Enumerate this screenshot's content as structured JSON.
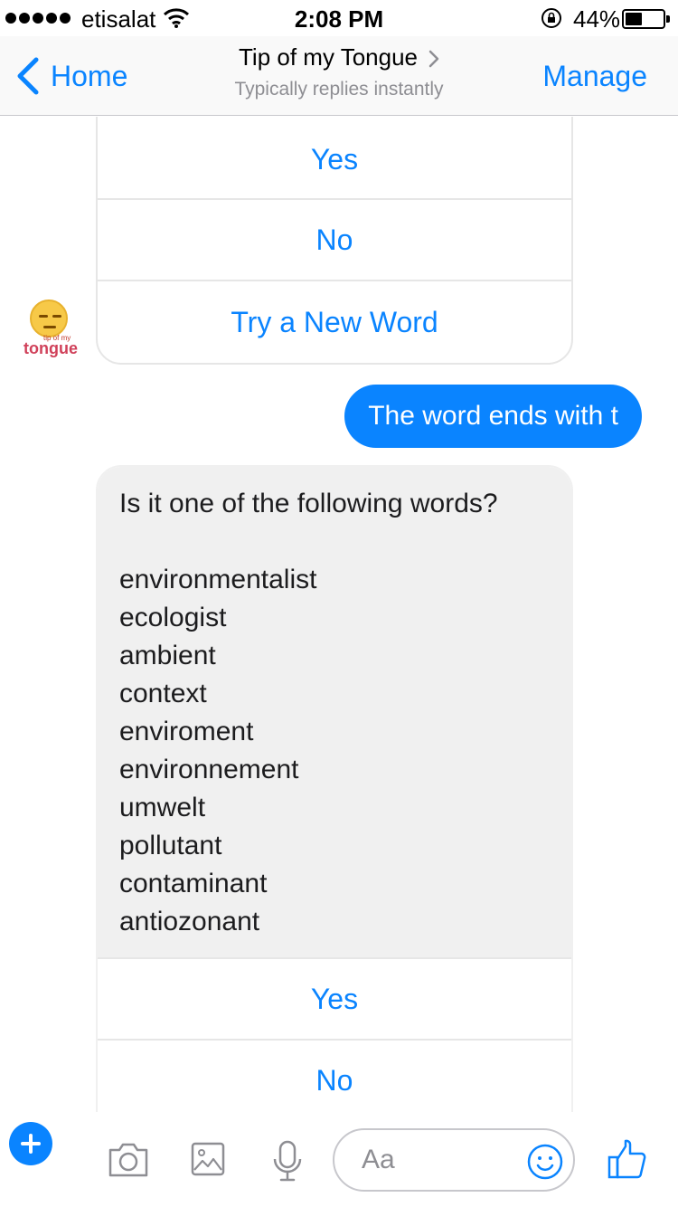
{
  "status_bar": {
    "carrier": "etisalat",
    "time": "2:08 PM",
    "battery_percent": "44%"
  },
  "nav": {
    "back_label": "Home",
    "title": "Tip of my Tongue",
    "subtitle": "Typically replies instantly",
    "manage_label": "Manage"
  },
  "avatar": {
    "small_text": "tip of my",
    "text": "tongue"
  },
  "first_card": {
    "replies": [
      "Yes",
      "No",
      "Try a New Word"
    ]
  },
  "outgoing_message": "The word ends with t",
  "incoming_message": {
    "question": "Is it one of the following words?",
    "words": [
      "environmentalist",
      "ecologist",
      "ambient",
      "context",
      "enviroment",
      "environnement",
      "umwelt",
      "pollutant",
      "contaminant",
      "antiozonant"
    ],
    "replies": [
      "Yes",
      "No"
    ]
  },
  "composer": {
    "placeholder": "Aa"
  },
  "colors": {
    "accent": "#0a84ff",
    "incoming_bubble": "#f0f0f0"
  }
}
